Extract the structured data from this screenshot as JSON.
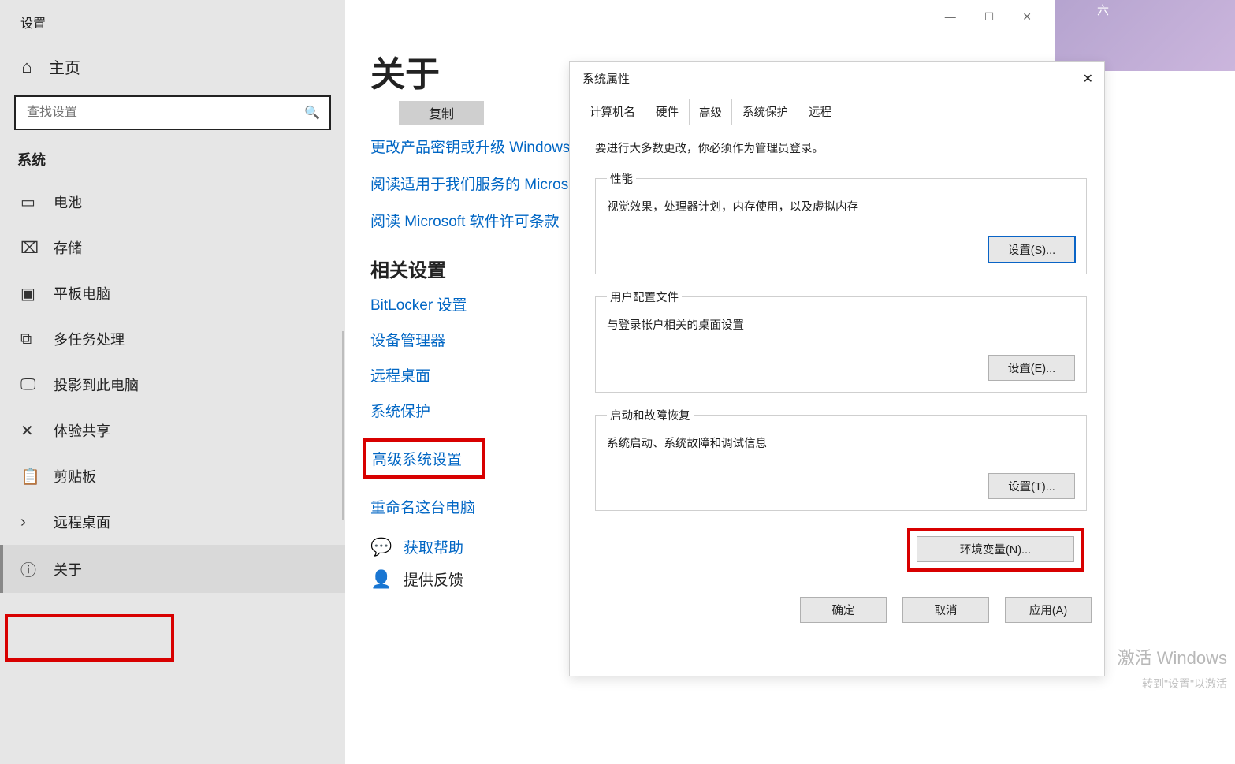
{
  "settings": {
    "title": "设置",
    "home": "主页",
    "searchPlaceholder": "查找设置",
    "category": "系统",
    "nav": [
      {
        "icon": "▭",
        "label": "电池"
      },
      {
        "icon": "⌧",
        "label": "存储"
      },
      {
        "icon": "▣",
        "label": "平板电脑"
      },
      {
        "icon": "⧉",
        "label": "多任务处理"
      },
      {
        "icon": "🖵",
        "label": "投影到此电脑"
      },
      {
        "icon": "✕",
        "label": "体验共享"
      },
      {
        "icon": "📋",
        "label": "剪贴板"
      },
      {
        "icon": "›",
        "label": "远程桌面"
      },
      {
        "icon": "ⓘ",
        "label": "关于"
      }
    ]
  },
  "rightStripDay": "六",
  "main": {
    "heading": "关于",
    "copy": "复制",
    "links1": [
      "更改产品密钥或升级 Windows",
      "阅读适用于我们服务的 Micros",
      "阅读 Microsoft 软件许可条款"
    ],
    "relatedHeading": "相关设置",
    "related": [
      "BitLocker 设置",
      "设备管理器",
      "远程桌面",
      "系统保护",
      "高级系统设置",
      "重命名这台电脑"
    ],
    "getHelp": "获取帮助",
    "feedback": "提供反馈"
  },
  "dialog": {
    "title": "系统属性",
    "tabs": [
      "计算机名",
      "硬件",
      "高级",
      "系统保护",
      "远程"
    ],
    "activeTab": 2,
    "adminNote": "要进行大多数更改，你必须作为管理员登录。",
    "perf": {
      "legend": "性能",
      "desc": "视觉效果，处理器计划，内存使用，以及虚拟内存",
      "btn": "设置(S)..."
    },
    "profiles": {
      "legend": "用户配置文件",
      "desc": "与登录帐户相关的桌面设置",
      "btn": "设置(E)..."
    },
    "startup": {
      "legend": "启动和故障恢复",
      "desc": "系统启动、系统故障和调试信息",
      "btn": "设置(T)..."
    },
    "envBtn": "环境变量(N)...",
    "ok": "确定",
    "cancel": "取消",
    "apply": "应用(A)"
  },
  "watermark": {
    "l1": "激活 Windows",
    "l2": "转到\"设置\"以激活"
  }
}
